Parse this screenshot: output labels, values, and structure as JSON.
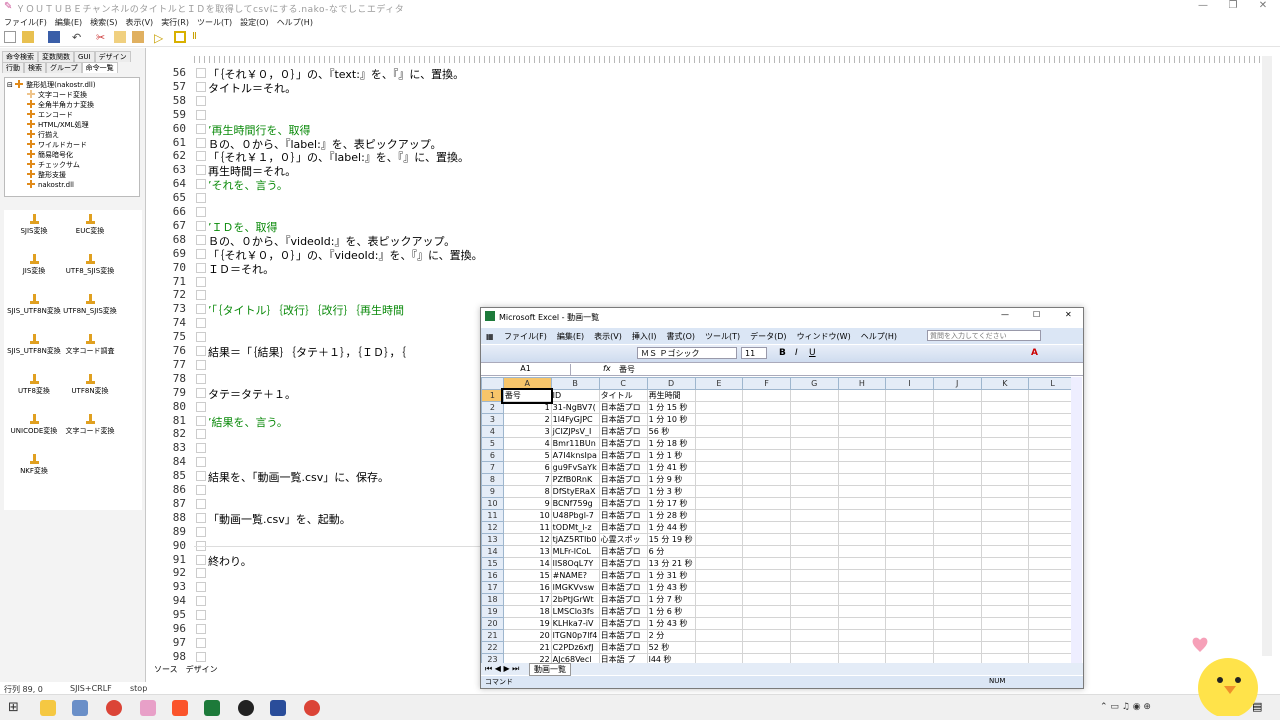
{
  "window": {
    "title": "ＹＯＵＴＵＢＥチャンネルのタイトルとＩＤを取得してcsvにする.nako-なでしこエディタ"
  },
  "menu": [
    "ファイル(F)",
    "編集(E)",
    "検索(S)",
    "表示(V)",
    "実行(R)",
    "ツール(T)",
    "設定(O)",
    "ヘルプ(H)"
  ],
  "left_tabs_top": [
    "命令検索",
    "変数関数",
    "GUI",
    "デザイン"
  ],
  "left_tabs_bottom": [
    "行動",
    "検索",
    "グループ",
    "命令一覧"
  ],
  "tree": [
    "整形処理(nakostr.dll)",
    "文字コード変換",
    "全角半角カナ変換",
    "エンコード",
    "HTML/XML処理",
    "行揃え",
    "ワイルドカード",
    "簡易暗号化",
    "チェックサム",
    "整形支援",
    "nakostr.dll"
  ],
  "commands": [
    [
      "SJIS変換",
      "EUC変換"
    ],
    [
      "JIS変換",
      "UTF8_SJIS変換"
    ],
    [
      "SJIS_UTF8N変換",
      "UTF8N_SJIS変換"
    ],
    [
      "SJIS_UTF8N変換",
      "文字コード調査"
    ],
    [
      "UTF8変換",
      "UTF8N変換"
    ],
    [
      "UNICODE変換",
      "文字コード変換"
    ],
    [
      "NKF変換",
      ""
    ]
  ],
  "code": [
    {
      "n": "56",
      "t": "「｛それ￥０，０｝」の、『text:』を、『』に、置換。",
      "c": ""
    },
    {
      "n": "57",
      "t": "タイトル＝それ。",
      "c": ""
    },
    {
      "n": "58",
      "t": "",
      "c": ""
    },
    {
      "n": "59",
      "t": "",
      "c": ""
    },
    {
      "n": "60",
      "t": "’再生時間行を、取得",
      "c": "cm"
    },
    {
      "n": "61",
      "t": "Ｂの、０から、『label:』を、表ピックアップ。",
      "c": ""
    },
    {
      "n": "62",
      "t": "「｛それ￥１，０｝」の、『label:』を、『』に、置換。",
      "c": ""
    },
    {
      "n": "63",
      "t": "再生時間＝それ。",
      "c": ""
    },
    {
      "n": "64",
      "t": "’それを、言う。",
      "c": "cm"
    },
    {
      "n": "65",
      "t": "",
      "c": ""
    },
    {
      "n": "66",
      "t": "",
      "c": ""
    },
    {
      "n": "67",
      "t": "’ＩＤを、取得",
      "c": "cm"
    },
    {
      "n": "68",
      "t": "Ｂの、０から、『videoId:』を、表ピックアップ。",
      "c": ""
    },
    {
      "n": "69",
      "t": "「｛それ￥０，０｝」の、『videoId:』を、『』に、置換。",
      "c": ""
    },
    {
      "n": "70",
      "t": "ＩＤ＝それ。",
      "c": ""
    },
    {
      "n": "71",
      "t": "",
      "c": ""
    },
    {
      "n": "72",
      "t": "",
      "c": ""
    },
    {
      "n": "73",
      "t": "’「｛タイトル｝｛改行｝｛改行｝｛再生時間",
      "c": "cm"
    },
    {
      "n": "74",
      "t": "",
      "c": ""
    },
    {
      "n": "75",
      "t": "",
      "c": ""
    },
    {
      "n": "76",
      "t": "結果＝「｛結果｝｛タテ＋１｝，｛ＩＤ｝，｛",
      "c": ""
    },
    {
      "n": "77",
      "t": "",
      "c": ""
    },
    {
      "n": "78",
      "t": "",
      "c": ""
    },
    {
      "n": "79",
      "t": "タテ＝タテ＋１。",
      "c": ""
    },
    {
      "n": "80",
      "t": "",
      "c": ""
    },
    {
      "n": "81",
      "t": "’結果を、言う。",
      "c": "cm"
    },
    {
      "n": "82",
      "t": "",
      "c": ""
    },
    {
      "n": "83",
      "t": "",
      "c": ""
    },
    {
      "n": "84",
      "t": "",
      "c": ""
    },
    {
      "n": "85",
      "t": "結果を、「動画一覧.csv」に、保存。",
      "c": ""
    },
    {
      "n": "86",
      "t": "",
      "c": ""
    },
    {
      "n": "87",
      "t": "",
      "c": ""
    },
    {
      "n": "88",
      "t": "「動画一覧.csv」を、起動。",
      "c": ""
    },
    {
      "n": "89",
      "t": "",
      "c": ""
    },
    {
      "n": "90",
      "t": "",
      "c": ""
    },
    {
      "n": "91",
      "t": "終わり。",
      "c": ""
    },
    {
      "n": "92",
      "t": "",
      "c": ""
    },
    {
      "n": "93",
      "t": "",
      "c": ""
    },
    {
      "n": "94",
      "t": "",
      "c": ""
    },
    {
      "n": "95",
      "t": "",
      "c": ""
    },
    {
      "n": "96",
      "t": "",
      "c": ""
    },
    {
      "n": "97",
      "t": "",
      "c": ""
    },
    {
      "n": "98",
      "t": "",
      "c": ""
    }
  ],
  "editor_tabs": [
    "ソース",
    "デザイン"
  ],
  "status": {
    "pos": "行列 89, 0",
    "enc": "SJIS+CRLF",
    "state": "stop"
  },
  "excel": {
    "title": "Microsoft Excel - 動画一覧",
    "menu": [
      "ファイル(F)",
      "編集(E)",
      "表示(V)",
      "挿入(I)",
      "書式(O)",
      "ツール(T)",
      "データ(D)",
      "ウィンドウ(W)",
      "ヘルプ(H)"
    ],
    "help_placeholder": "質問を入力してください",
    "font": "ＭＳ Ｐゴシック",
    "size": "11",
    "cell_ref": "A1",
    "formula": "番号",
    "cols": [
      "A",
      "B",
      "C",
      "D",
      "E",
      "F",
      "G",
      "H",
      "I",
      "J",
      "K",
      "L"
    ],
    "rows": [
      [
        "番号",
        "ID",
        "タイトル",
        "再生時間"
      ],
      [
        "1",
        "31-NgBV7(",
        "日本語プロ",
        "1 分 15 秒"
      ],
      [
        "2",
        "1l4FyGJPC",
        "日本語プロ",
        "1 分 10 秒"
      ],
      [
        "3",
        "jCIZJPsV_I",
        "日本語プロ",
        "56 秒"
      ],
      [
        "4",
        "Bmr11BUn",
        "日本語プロ",
        "1 分 18 秒"
      ],
      [
        "5",
        "A7I4knsIpa",
        "日本語プロ",
        "1 分 1 秒"
      ],
      [
        "6",
        "gu9FvSaYk",
        "日本語プロ",
        "1 分 41 秒"
      ],
      [
        "7",
        "PZfB0RnK",
        "日本語プロ",
        "1 分 9 秒"
      ],
      [
        "8",
        "DfStyERaX",
        "日本語プロ",
        "1 分 3 秒"
      ],
      [
        "9",
        "BCNf759g",
        "日本語プロ",
        "1 分 17 秒"
      ],
      [
        "10",
        "U48Pbgl-7",
        "日本語プロ",
        "1 分 28 秒"
      ],
      [
        "11",
        "tODMt_l-z",
        "日本語プロ",
        "1 分 44 秒"
      ],
      [
        "12",
        "tjAZ5RTIb0",
        "心霊スポッ",
        "15 分 19 秒"
      ],
      [
        "13",
        "MLFr-lCoL",
        "日本語プロ",
        "6 分"
      ],
      [
        "14",
        "lIS8OqL7Y",
        "日本語プロ",
        "13 分 21 秒"
      ],
      [
        "15",
        "#NAME?",
        "日本語プロ",
        "1 分 31 秒"
      ],
      [
        "16",
        "lMGKVvsw",
        "日本語プロ",
        "1 分 43 秒"
      ],
      [
        "17",
        "2bPtJGrWt",
        "日本語プロ",
        "1 分 7 秒"
      ],
      [
        "18",
        "LMSClo3fs",
        "日本語プロ",
        "1 分 6 秒"
      ],
      [
        "19",
        "KLHka7-iV",
        "日本語プロ",
        "1 分 43 秒"
      ],
      [
        "20",
        "lTGN0p7lf4",
        "日本語プロ",
        "2 分"
      ],
      [
        "21",
        "C2PDz6xfJ",
        "日本語プロ",
        "52 秒"
      ],
      [
        "22",
        "AJc68Vecl",
        "日本語 プ",
        "l44 秒"
      ]
    ],
    "sheet_tab": "動画一覧",
    "status_left": "コマンド",
    "status_num": "NUM"
  },
  "taskbar": {
    "time": "",
    "icons": [
      "start-icon",
      "file-explorer-icon",
      "nadesiko-icon",
      "chrome-icon",
      "paint-icon",
      "brave-icon",
      "excel-icon",
      "obs-icon",
      "app-icon",
      "chrome-icon"
    ]
  }
}
